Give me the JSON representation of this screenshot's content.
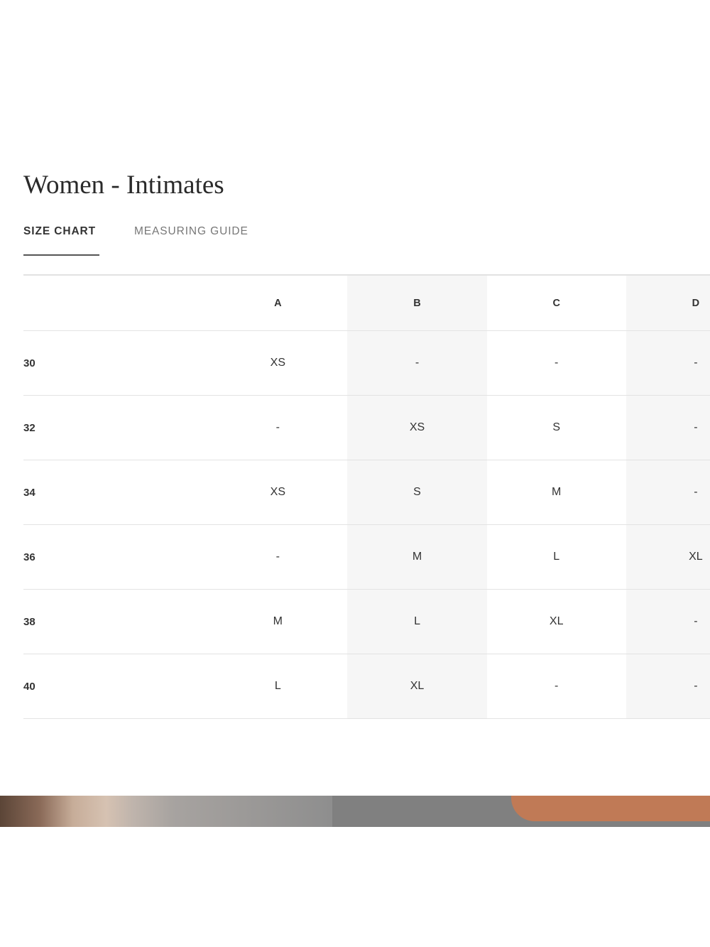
{
  "title": "Women - Intimates",
  "tabs": [
    {
      "label": "SIZE CHART",
      "active": true
    },
    {
      "label": "MEASURING GUIDE",
      "active": false
    }
  ],
  "table": {
    "columns": [
      "",
      "A",
      "B",
      "C",
      "D"
    ],
    "rows": [
      {
        "band": "30",
        "cells": [
          "XS",
          "-",
          "-",
          "-"
        ]
      },
      {
        "band": "32",
        "cells": [
          "-",
          "XS",
          "S",
          "-"
        ]
      },
      {
        "band": "34",
        "cells": [
          "XS",
          "S",
          "M",
          "-"
        ]
      },
      {
        "band": "36",
        "cells": [
          "-",
          "M",
          "L",
          "XL"
        ]
      },
      {
        "band": "38",
        "cells": [
          "M",
          "L",
          "XL",
          "-"
        ]
      },
      {
        "band": "40",
        "cells": [
          "L",
          "XL",
          "-",
          "-"
        ]
      }
    ]
  },
  "colors": {
    "text": "#2b2b2b",
    "shaded_column": "#f6f6f6",
    "divider": "#e3e3e3",
    "backdrop_gray": "#808080",
    "backdrop_fabric": "#c07a56"
  }
}
